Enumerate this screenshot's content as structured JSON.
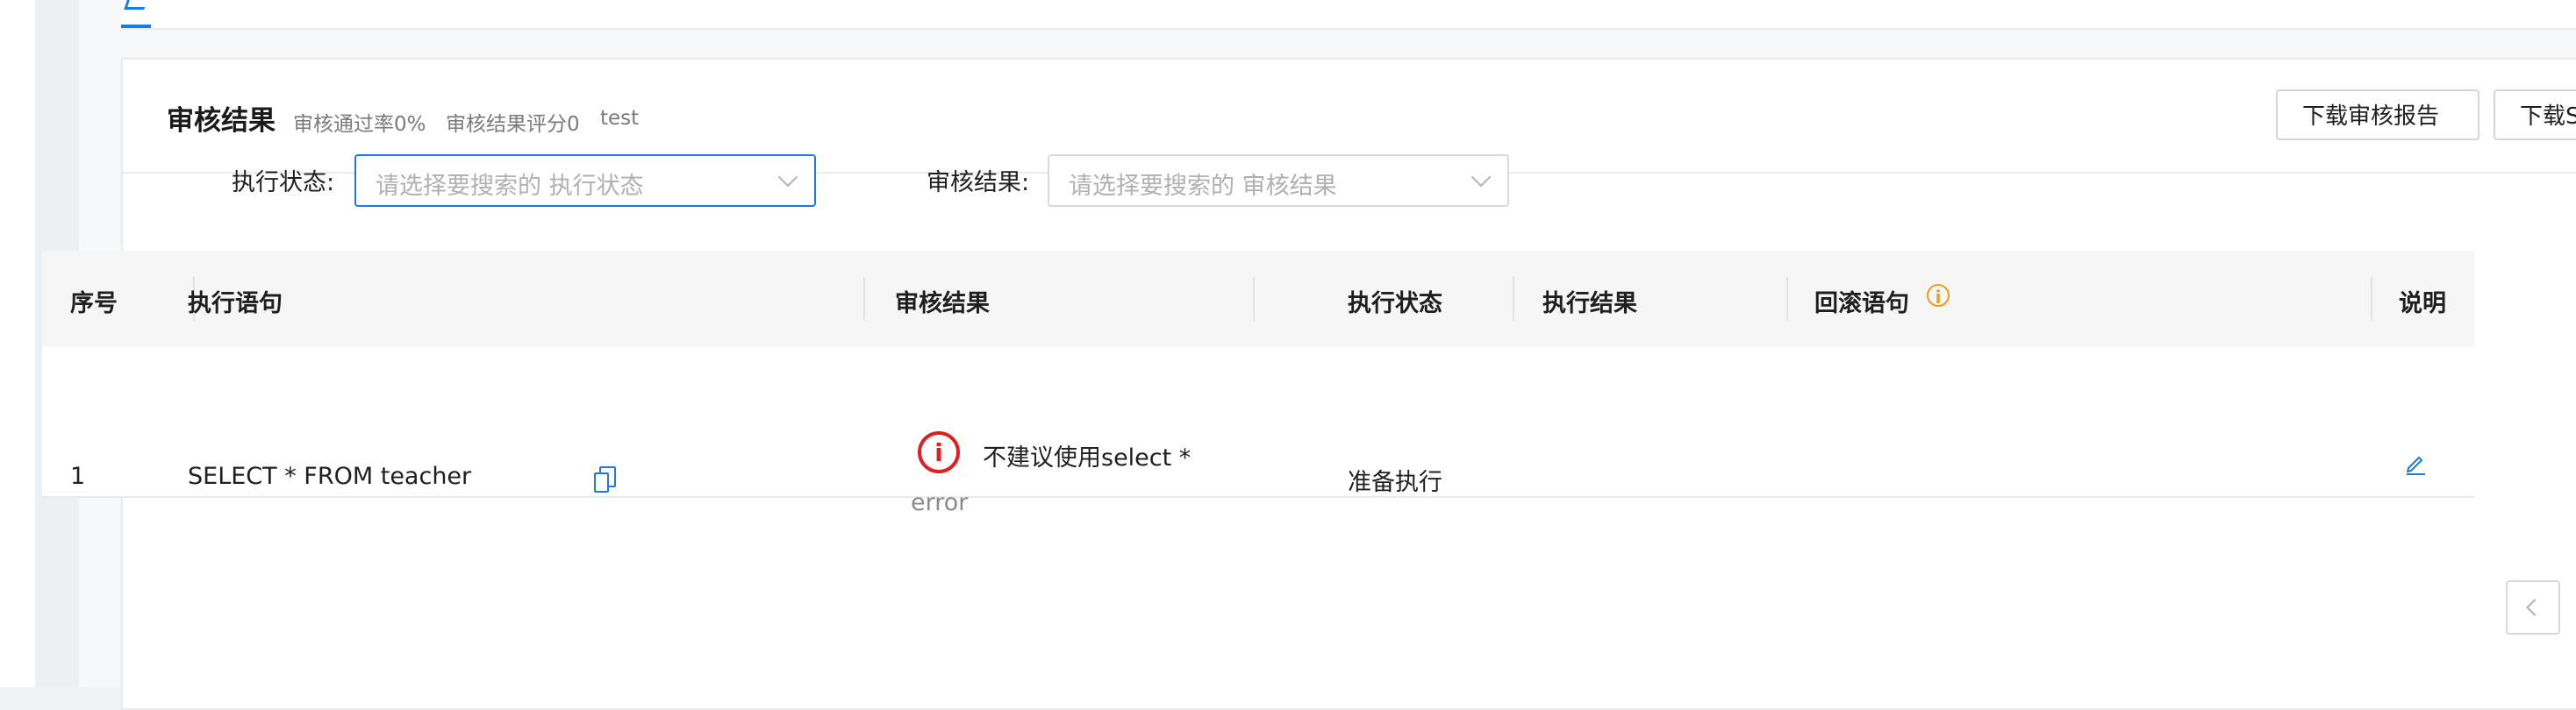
{
  "card": {
    "title": "审核结果",
    "pass_rate": "审核通过率0%",
    "score": "审核结果评分0",
    "tag": "test",
    "download_report_button": "下载审核报告",
    "download_sql_button": "下载SQL语句"
  },
  "filters": {
    "exec_status_label": "执行状态:",
    "exec_status_placeholder": "请选择要搜索的 执行状态",
    "audit_result_label": "审核结果:",
    "audit_result_placeholder": "请选择要搜索的 审核结果"
  },
  "table": {
    "columns": [
      "序号",
      "执行语句",
      "审核结果",
      "执行状态",
      "执行结果",
      "回滚语句",
      "说明"
    ],
    "rows": [
      {
        "index": "1",
        "statement": "SELECT * FROM teacher",
        "audit_message": "不建议使用select *",
        "audit_level": "error",
        "exec_status": "准备执行",
        "exec_result": "",
        "rollback": "",
        "description": ""
      }
    ]
  },
  "colors": {
    "primary": "#1f7ae0",
    "error": "#e02020",
    "warning": "#f09a1e"
  },
  "icons": [
    "copy-icon",
    "error-icon",
    "info-icon",
    "edit-icon",
    "chevron-down-icon",
    "chevron-left-icon"
  ]
}
